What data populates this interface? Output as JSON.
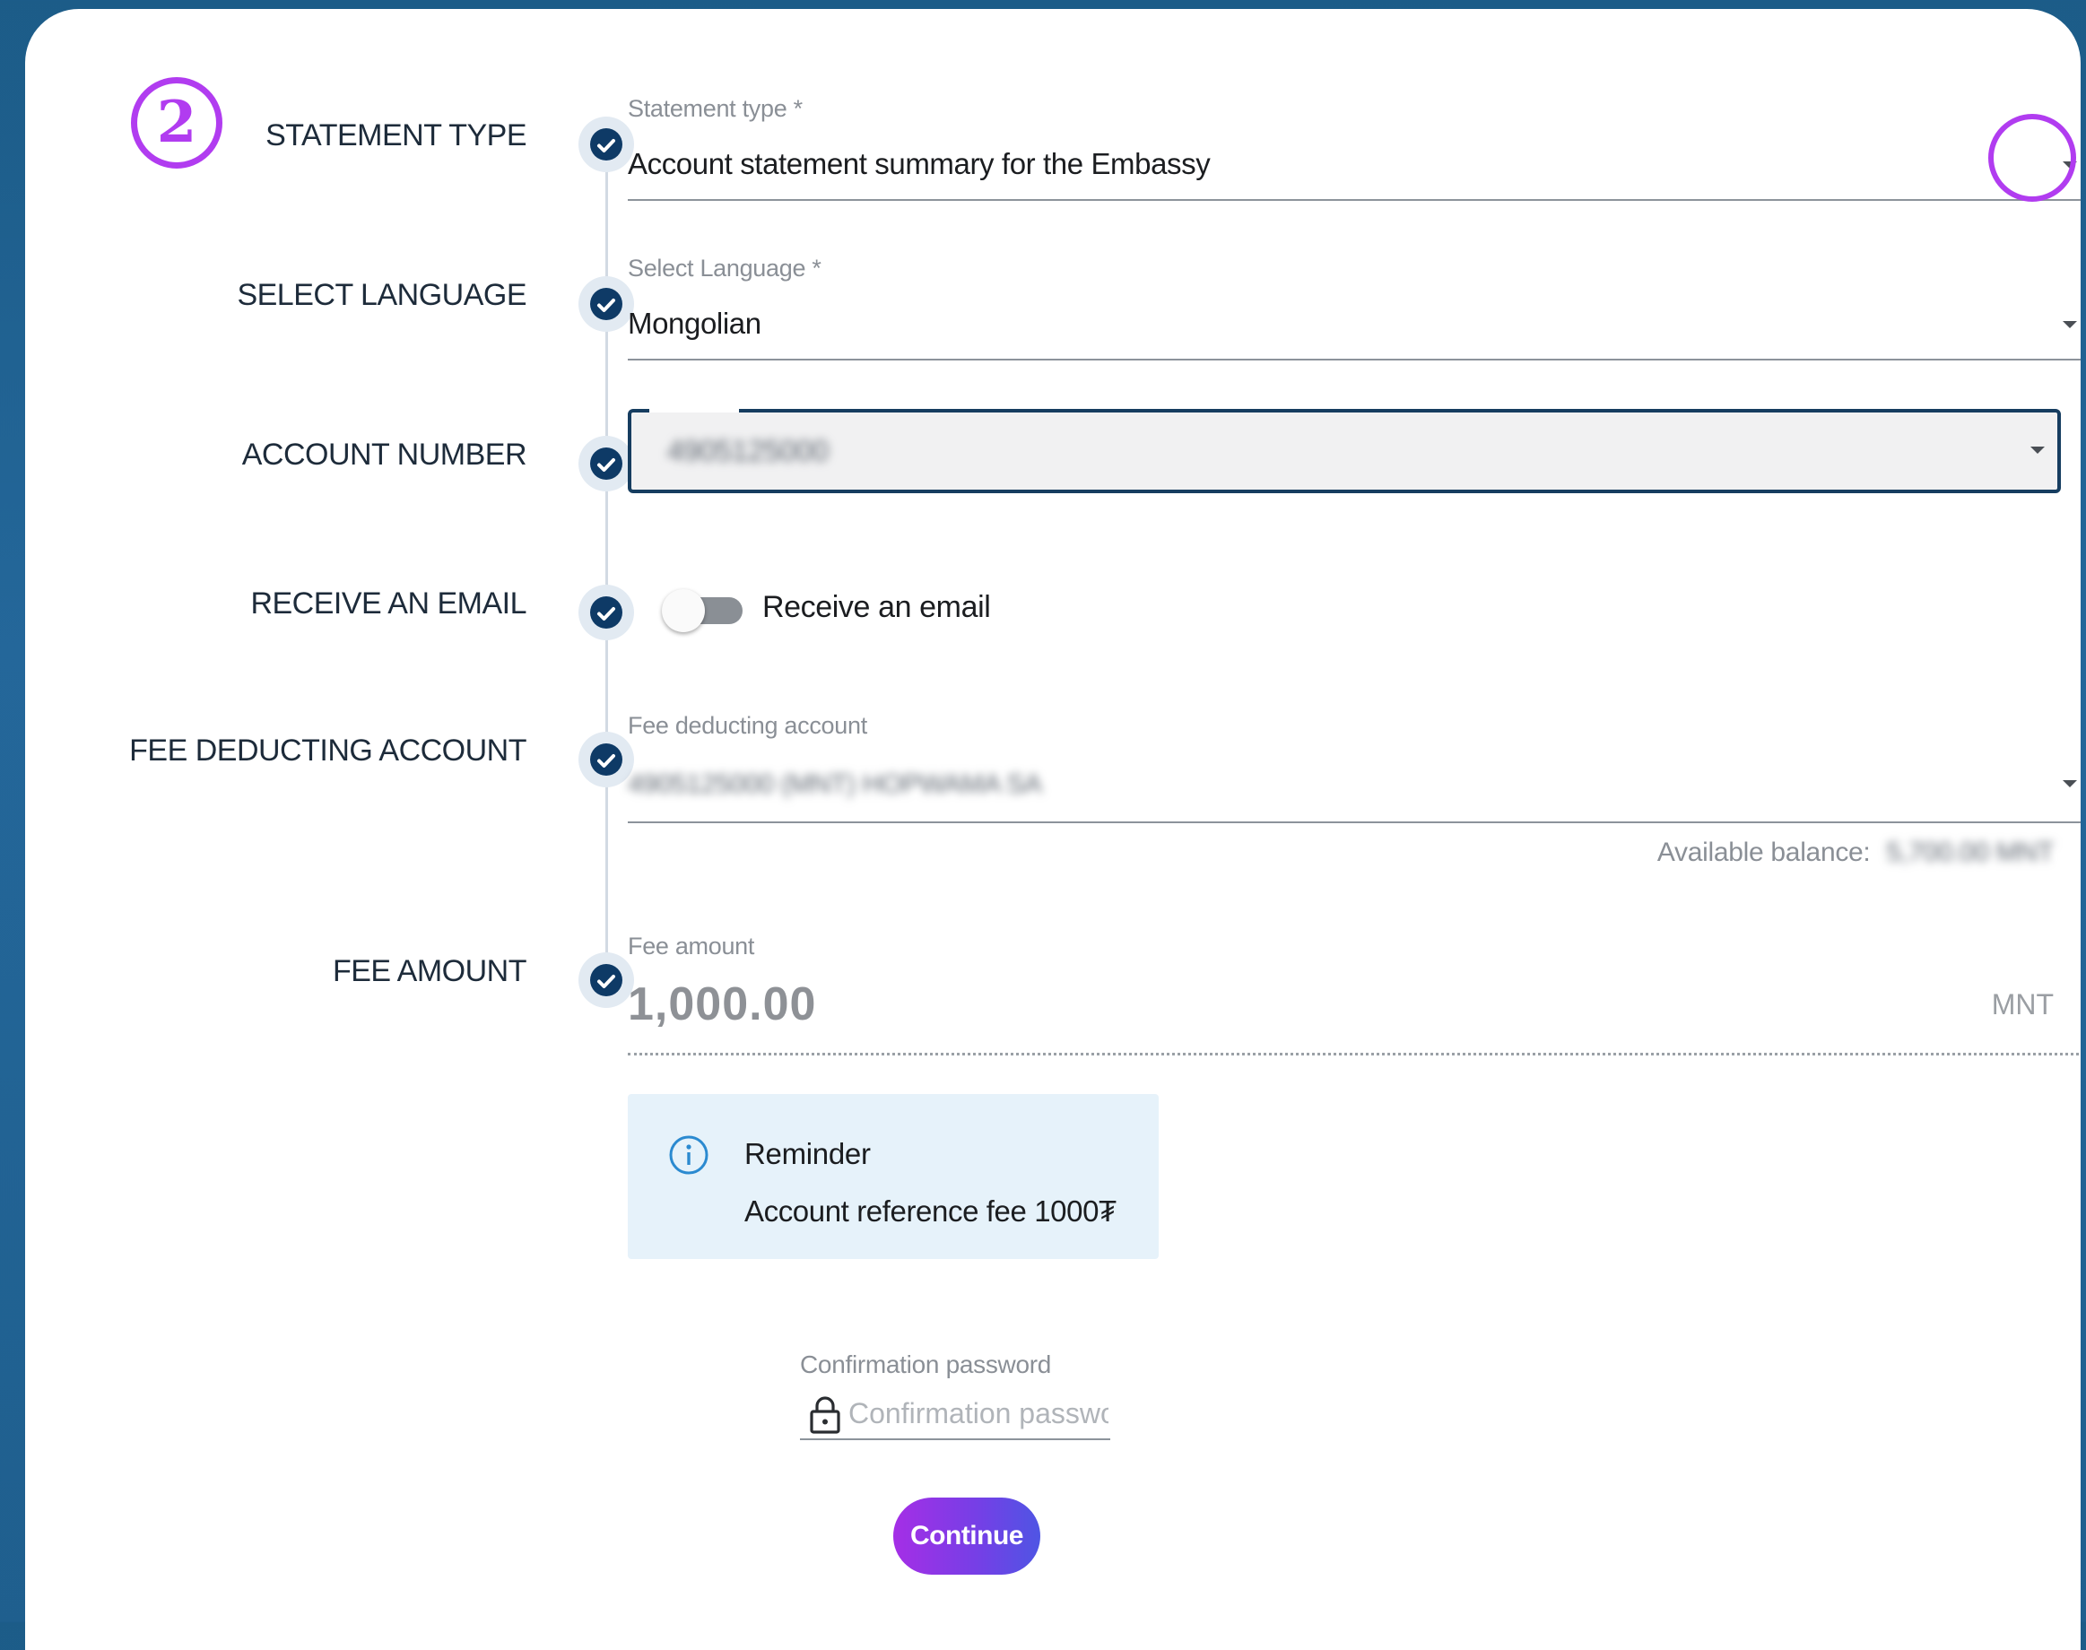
{
  "step_number": "2",
  "steps": [
    {
      "label": "STATEMENT TYPE"
    },
    {
      "label": "SELECT LANGUAGE"
    },
    {
      "label": "ACCOUNT NUMBER"
    },
    {
      "label": "RECEIVE AN EMAIL"
    },
    {
      "label": "FEE DEDUCTING ACCOUNT"
    },
    {
      "label": "FEE AMOUNT"
    }
  ],
  "statement_type": {
    "label": "Statement type *",
    "value": "Account statement summary for the Embassy"
  },
  "language": {
    "label": "Select Language *",
    "value": "Mongolian"
  },
  "account_number": {
    "value": "4905125000"
  },
  "email_toggle": {
    "label": "Receive an email",
    "on": false
  },
  "fee_account": {
    "label": "Fee deducting account",
    "value": "4905125000 (MNT) HOPWAMA SA",
    "balance_label": "Available balance:",
    "balance_value": "5,700.00 MNT"
  },
  "fee_amount": {
    "label": "Fee amount",
    "value": "1,000.00",
    "currency": "MNT"
  },
  "reminder": {
    "title": "Reminder",
    "text": "Account reference fee 1000₮"
  },
  "confirmation": {
    "label": "Confirmation password",
    "placeholder": "Confirmation password"
  },
  "continue_label": "Continue",
  "colors": {
    "accent": "#b13cf0",
    "step_dot": "#0e3a66",
    "background": "#1f5f8e"
  }
}
